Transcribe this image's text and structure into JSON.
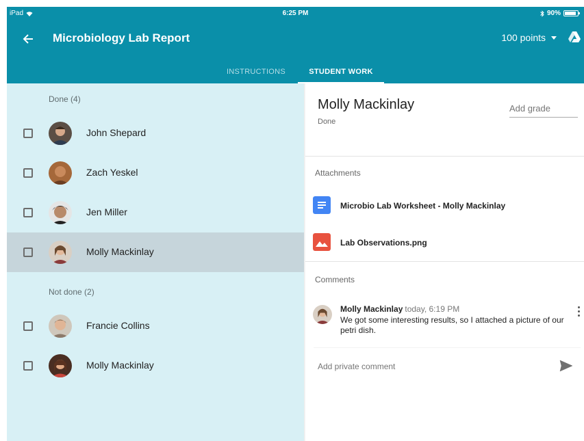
{
  "status_bar": {
    "device": "iPad",
    "time": "6:25 PM",
    "battery": "90%",
    "battery_level": 0.9
  },
  "app_bar": {
    "title": "Microbiology Lab Report",
    "points": "100 points"
  },
  "tabs": [
    {
      "label": "INSTRUCTIONS",
      "active": false
    },
    {
      "label": "STUDENT WORK",
      "active": true
    }
  ],
  "student_list": {
    "done_header": "Done (4)",
    "not_done_header": "Not done (2)",
    "done": [
      {
        "name": "John Shepard",
        "selected": false
      },
      {
        "name": "Zach Yeskel",
        "selected": false
      },
      {
        "name": "Jen Miller",
        "selected": false
      },
      {
        "name": "Molly Mackinlay",
        "selected": true
      }
    ],
    "not_done": [
      {
        "name": "Francie Collins",
        "selected": false
      },
      {
        "name": "Molly Mackinlay",
        "selected": false
      }
    ]
  },
  "detail": {
    "student_name": "Molly Mackinlay",
    "status": "Done",
    "grade_placeholder": "Add grade",
    "attachments_label": "Attachments",
    "attachments": [
      {
        "name": "Microbio Lab Worksheet - Molly Mackinlay",
        "icon": "google-docs-icon",
        "color": "#4285f4"
      },
      {
        "name": "Lab Observations.png",
        "icon": "image-file-icon",
        "color": "#e8523f"
      }
    ],
    "comments_label": "Comments",
    "comment": {
      "author": "Molly Mackinlay",
      "time": "today, 6:19 PM",
      "text": "We got some interesting results, so I attached a picture of our petri dish."
    },
    "private_comment_placeholder": "Add private comment"
  },
  "colors": {
    "accent": "#0a8fa9",
    "list_bg": "#d8f0f5",
    "selected_row": "#c6d5db"
  }
}
